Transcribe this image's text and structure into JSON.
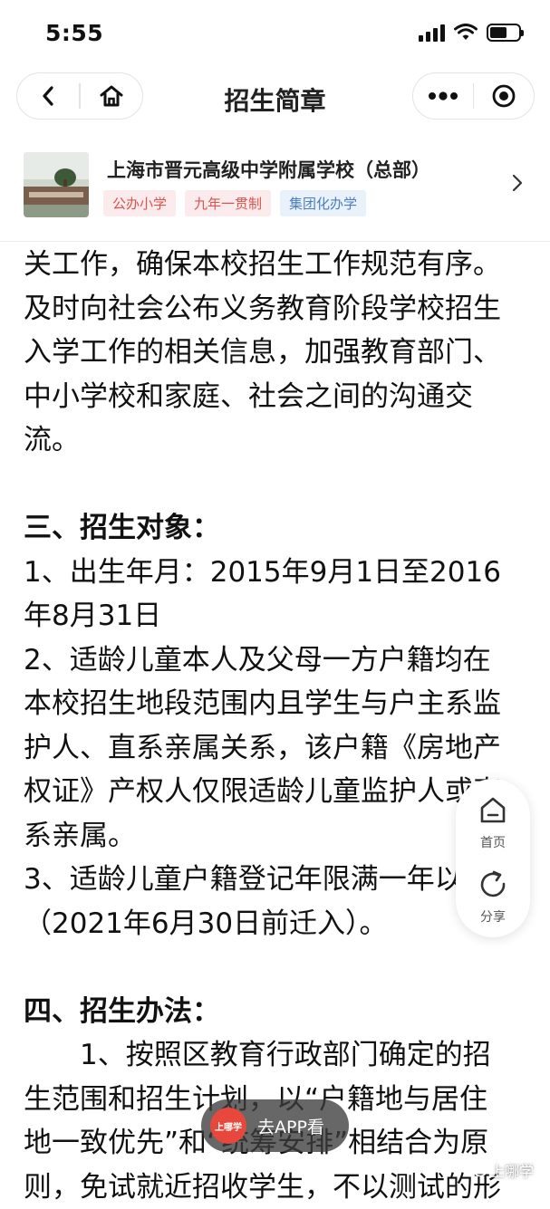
{
  "status_bar": {
    "time": "5:55"
  },
  "nav": {
    "title": "招生简章"
  },
  "school": {
    "name": "上海市晋元高级中学附属学校（总部）",
    "tags": [
      "公办小学",
      "九年一贯制",
      "集团化办学"
    ]
  },
  "article": {
    "lines": [
      "关工作，确保本校招生工作规范有序。",
      "及时向社会公布义务教育阶段学校招生",
      "入学工作的相关信息，加强教育部门、",
      "中小学校和家庭、社会之间的沟通交",
      "流。"
    ],
    "section3_title": "三、招生对象：",
    "section3_lines": [
      "1、出生年月：2015年9月1日至2016",
      "年8月31日",
      "2、适龄儿童本人及父母一方户籍均在",
      "本校招生地段范围内且学生与户主系监",
      "护人、直系亲属关系，该户籍《房地产",
      "权证》产权人仅限适龄儿童监护人或直",
      "系亲属。",
      "3、适龄儿童户籍登记年限满一年以上",
      "（2021年6月30日前迁入）。"
    ],
    "section4_title": "四、招生办法：",
    "section4_lines": [
      "1、按照区教育行政部门确定的招",
      "生范围和招生计划，以“户籍地与居住",
      "地一致优先”和“统筹安排”相结合为原",
      "则，免试就近招收学生，不以测试的形"
    ]
  },
  "float_bar": {
    "home_label": "首页",
    "share_label": "分享"
  },
  "app_button": {
    "logo_text": "上哪学",
    "label": "去APP看"
  },
  "watermark": {
    "text": "上哪学"
  }
}
